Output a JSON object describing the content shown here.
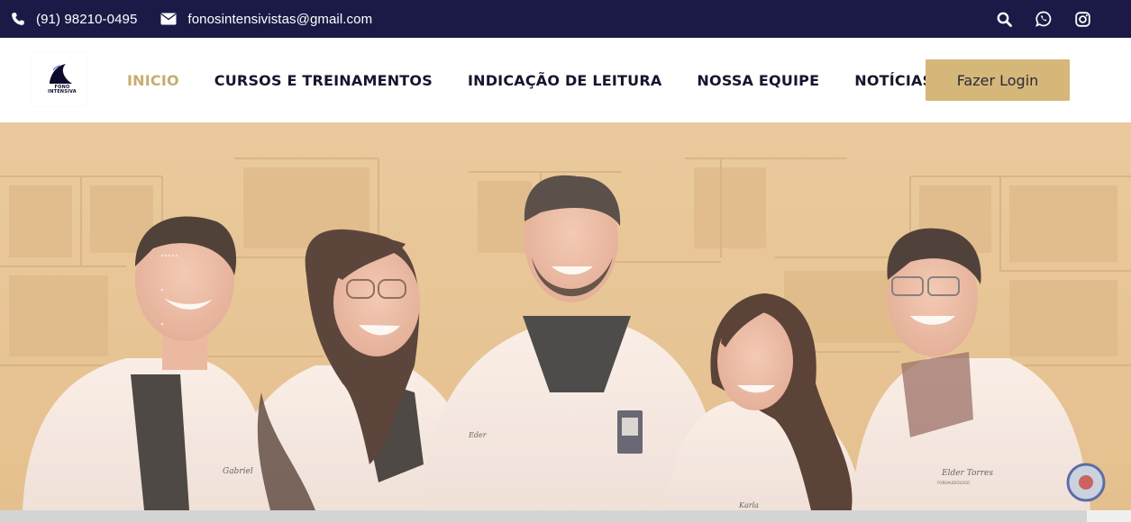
{
  "colors": {
    "topbar_bg": "#1b1a47",
    "accent_gold": "#c6ad71",
    "nav_text": "#15152e",
    "login_bg": "#d5b77a"
  },
  "topbar": {
    "phone": {
      "icon": "phone-icon",
      "text": "(91) 98210-0495"
    },
    "email": {
      "icon": "envelope-icon",
      "text": "fonosintensivistas@gmail.com"
    },
    "social_icons": [
      "search-icon",
      "whatsapp-icon",
      "instagram-icon"
    ]
  },
  "logo": {
    "line1": "FONO",
    "line2": "INTENSIVA"
  },
  "nav": {
    "items": [
      {
        "label": "INICIO",
        "active": true
      },
      {
        "label": "CURSOS E TREINAMENTOS",
        "active": false
      },
      {
        "label": "INDICAÇÃO DE LEITURA",
        "active": false
      },
      {
        "label": "NOSSA EQUIPE",
        "active": false
      },
      {
        "label": "NOTÍCIAS",
        "active": false
      }
    ],
    "login_label": "Fazer Login"
  },
  "hero": {
    "image": "team-photo",
    "overlay_dots": "......",
    "badge_names": [
      "Gabriel",
      "Eder",
      "Karla",
      "Elder Torres"
    ],
    "badge_subtitle": "FONOAUDIÓLOGO"
  }
}
